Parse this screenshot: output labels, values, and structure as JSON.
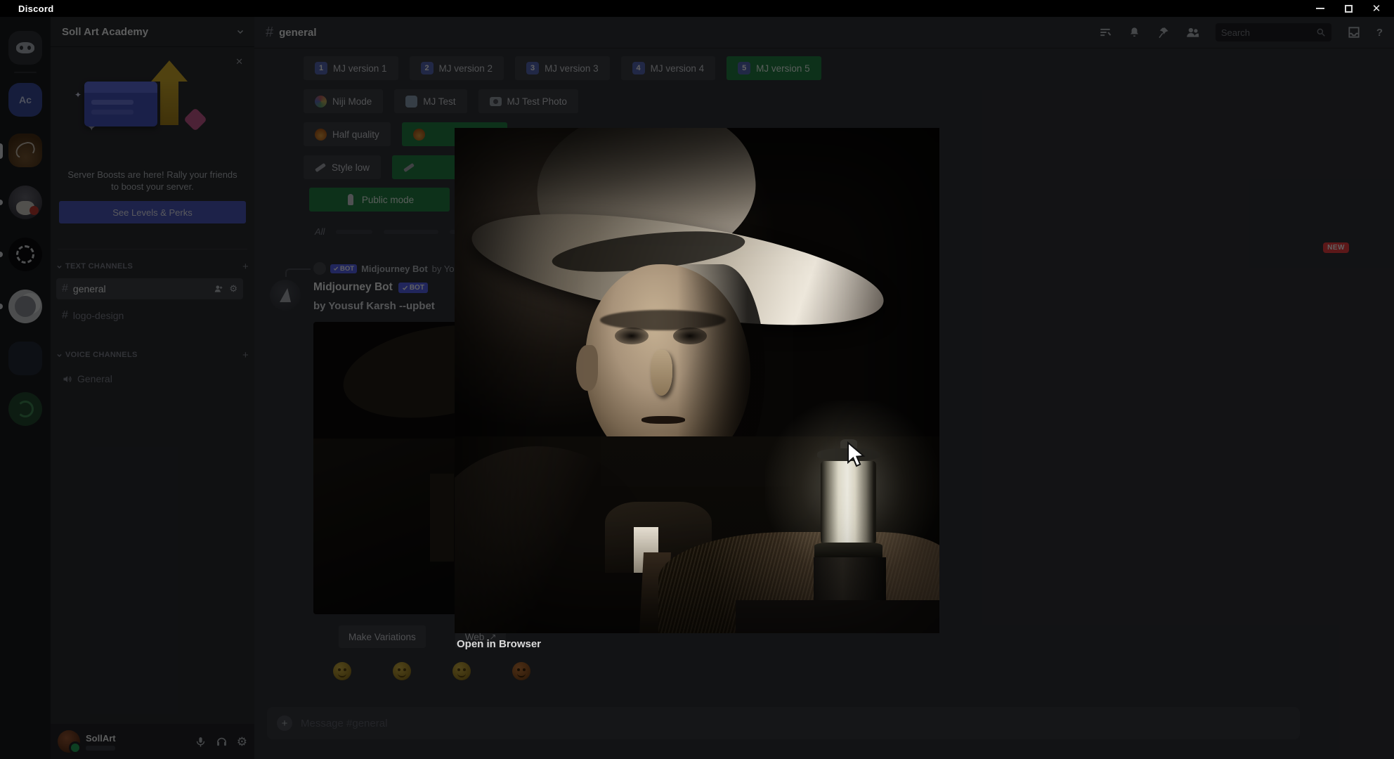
{
  "titlebar": {
    "app_name": "Discord"
  },
  "rail": {
    "server_ac_initials": "Ac",
    "servers": [
      "discord-home",
      "ac-server",
      "art-server",
      "wizard-server",
      "openai-server",
      "moon-server",
      "dim-server",
      "green-server"
    ]
  },
  "sidebar": {
    "server_name": "Soll Art Academy",
    "boost": {
      "message": "Server Boosts are here! Rally your friends to boost your server.",
      "cta_label": "See Levels & Perks"
    },
    "text_channels_label": "TEXT CHANNELS",
    "voice_channels_label": "VOICE CHANNELS",
    "channels": {
      "general": "general",
      "logo_design": "logo-design",
      "voice_general": "General"
    },
    "user": {
      "name": "SollArt"
    }
  },
  "header": {
    "channel_name": "general",
    "search_placeholder": "Search"
  },
  "chat": {
    "version_buttons": [
      {
        "num": "1",
        "label": "MJ version 1"
      },
      {
        "num": "2",
        "label": "MJ version 2"
      },
      {
        "num": "3",
        "label": "MJ version 3"
      },
      {
        "num": "4",
        "label": "MJ version 4"
      },
      {
        "num": "5",
        "label": "MJ version 5"
      }
    ],
    "mode_buttons": [
      {
        "label": "Niji Mode"
      },
      {
        "label": "MJ Test"
      },
      {
        "label": "MJ Test Photo"
      }
    ],
    "quality_button": {
      "label": "Half quality"
    },
    "style_button": {
      "label": "Style low"
    },
    "public_button": {
      "label": "Public mode"
    },
    "all_label": "All",
    "new_badge": "NEW",
    "reply": {
      "bot_badge": "BOT",
      "author": "Midjourney Bot",
      "preview": "by Yousuf Karsh…"
    },
    "message": {
      "author": "Midjourney Bot",
      "bot_badge": "BOT",
      "prompt": "by Yousuf Karsh --upbet"
    },
    "actions": {
      "variations": "Make Variations",
      "web": "Web"
    }
  },
  "lightbox": {
    "open_link": "Open in Browser"
  },
  "composer": {
    "placeholder": "Message #general"
  },
  "icons": {
    "hash": "#",
    "plus": "+",
    "close": "✕",
    "help": "?",
    "sparkle": "✦",
    "gear": "⚙",
    "external": "↗"
  },
  "colors": {
    "accent_blurple": "#5865f2",
    "success_green": "#248046",
    "new_red": "#f23f42",
    "rail_bg": "#1a1b1e",
    "sidebar_bg": "#2b2d31",
    "chat_bg": "#313338"
  }
}
